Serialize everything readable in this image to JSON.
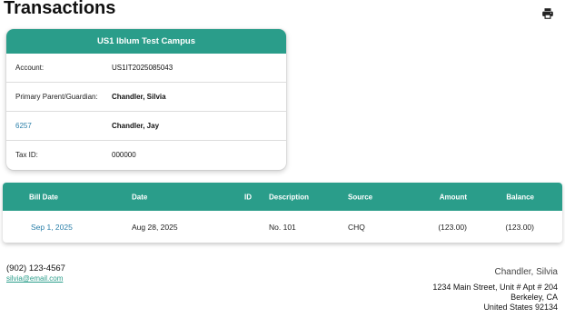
{
  "page": {
    "title": "Transactions"
  },
  "icons": {
    "print": "printer-icon"
  },
  "account_card": {
    "header": "US1 Iblum Test Campus",
    "rows": [
      {
        "key": "Account:",
        "value": "US1IT2025085043"
      },
      {
        "key": "Primary Parent/Guardian:",
        "value": "Chandler, Silvia"
      },
      {
        "key": "6257",
        "value": "Chandler, Jay"
      },
      {
        "key": "Tax ID:",
        "value": "000000"
      }
    ]
  },
  "transactions": {
    "columns": {
      "bill_date": "Bill Date",
      "date": "Date",
      "id": "ID",
      "description": "Description",
      "source": "Source",
      "amount": "Amount",
      "balance": "Balance"
    },
    "rows": [
      {
        "bill_date": "Sep 1, 2025",
        "date": "Aug 28, 2025",
        "id": "",
        "description": "No. 101",
        "source": "CHQ",
        "amount": "(123.00)",
        "balance": "(123.00)"
      }
    ]
  },
  "footer": {
    "phone": "(902) 123-4567",
    "email": "silvia@email.com",
    "name": "Chandler, Silvia",
    "address_line1": "1234 Main Street, Unit # Apt # 204",
    "address_line2": "Berkeley, CA",
    "address_line3": "United States 92134"
  },
  "colors": {
    "accent": "#2a9d8a",
    "link": "#2a7fa9"
  }
}
